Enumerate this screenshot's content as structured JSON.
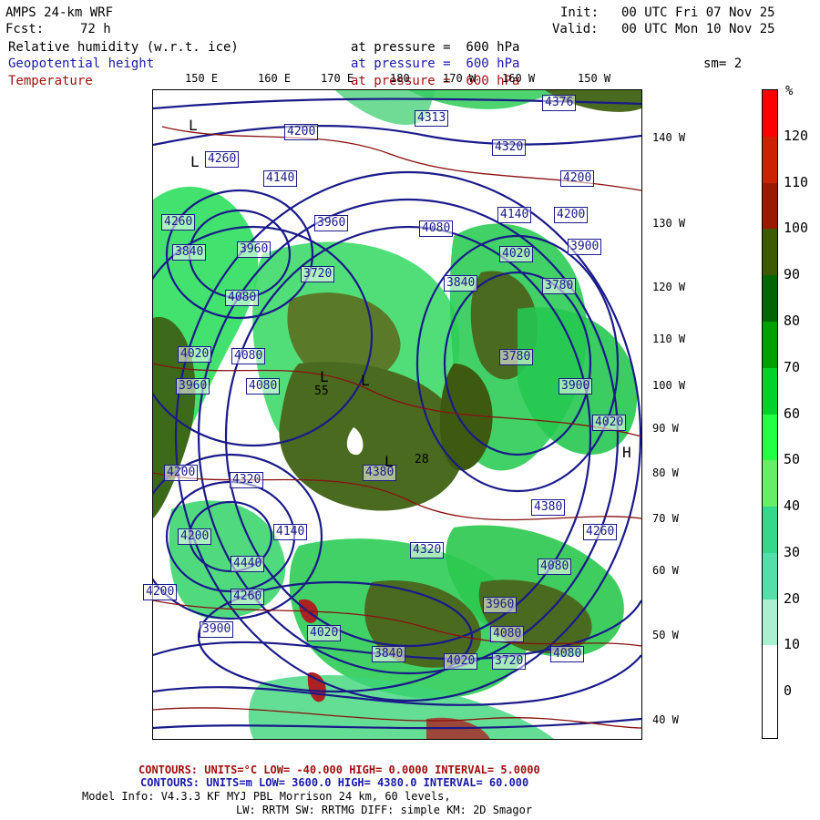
{
  "header": {
    "model_title": "AMPS 24-km WRF",
    "fcst_label": "Fcst:",
    "fcst_value": "72 h",
    "init_label": "Init:",
    "init_value": "00 UTC Fri 07 Nov 25",
    "valid_label": "Valid:",
    "valid_value": "00 UTC Mon 10 Nov 25"
  },
  "fields": [
    {
      "name": "Relative humidity (w.r.t. ice)",
      "pressure_text": "at pressure =  600 hPa",
      "color": "#000000"
    },
    {
      "name": "Geopotential height",
      "pressure_text": "at pressure =  600 hPa",
      "color": "#1a1aa8"
    },
    {
      "name": "Temperature",
      "pressure_text": "at pressure =  600 hPa",
      "color": "#a01010"
    }
  ],
  "smoothing": "sm= 2",
  "lon_labels": [
    "150 E",
    "160 E",
    "170 E",
    "180",
    "170 W",
    "160 W",
    "150 W"
  ],
  "lat_labels": [
    "140 W",
    "130 W",
    "120 W",
    "110 W",
    "100 W",
    "90 W",
    "80 W",
    "70 W",
    "60 W",
    "50 W",
    "40 W"
  ],
  "colorbar": {
    "unit": "%",
    "labels": [
      "120",
      "110",
      "100",
      "90",
      "80",
      "70",
      "60",
      "50",
      "40",
      "30",
      "20",
      "10",
      "0"
    ],
    "colors": [
      "#ff0000",
      "#cc2200",
      "#9a1a00",
      "#3d5a00",
      "#006600",
      "#00a000",
      "#00d22a",
      "#22ff44",
      "#66ee66",
      "#33d88a",
      "#55ddaa",
      "#aaf0d0",
      "#ffffff",
      "#ffffff"
    ]
  },
  "map_labels": {
    "height_contours": [
      "4200",
      "4313",
      "4376",
      "4260",
      "4320",
      "4140",
      "4200",
      "4260",
      "4140",
      "4200",
      "3960",
      "4080",
      "3900",
      "3840",
      "3960",
      "4020",
      "3780",
      "4080",
      "3720",
      "3840",
      "4020",
      "4080",
      "3780",
      "4080",
      "3900",
      "3960",
      "4020",
      "4200",
      "4320",
      "4380",
      "4200",
      "4140",
      "4260",
      "4380",
      "4440",
      "4080",
      "4200",
      "4260",
      "4320",
      "3960",
      "4080",
      "4020",
      "3900",
      "3840",
      "4020",
      "3720",
      "4080"
    ],
    "high_low_marks": [
      "L",
      "L",
      "H",
      "L",
      "L",
      "L"
    ],
    "contour_values": [
      "28",
      "55"
    ]
  },
  "footer": {
    "temp_line": "CONTOURS:  UNITS=°C  LOW= -40.000      HIGH=  0.0000      INTERVAL=   5.0000",
    "height_line": "CONTOURS:  UNITS=m  LOW=  3600.0      HIGH=  4380.0      INTERVAL=   60.000",
    "model_info": "Model Info: V4.3.3   KF      MYJ PBL  Morrison            24 km,   60 levels,",
    "physics_info": "LW: RRTM SW: RRTMG   DIFF: simple KM: 2D Smagor"
  }
}
